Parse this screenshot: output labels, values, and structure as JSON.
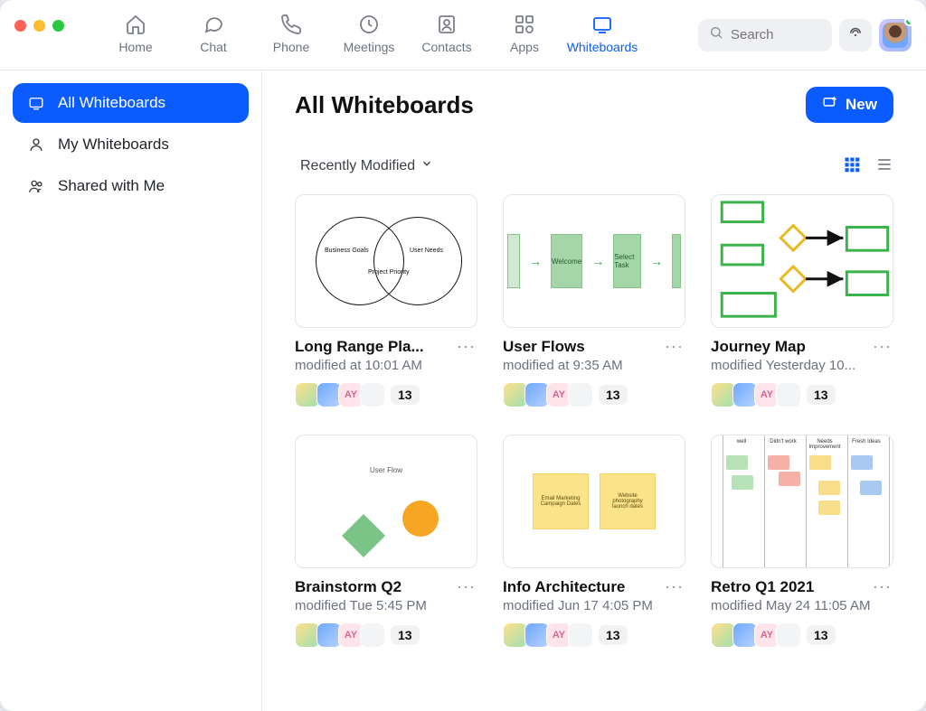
{
  "nav": {
    "items": [
      {
        "label": "Home"
      },
      {
        "label": "Chat"
      },
      {
        "label": "Phone"
      },
      {
        "label": "Meetings"
      },
      {
        "label": "Contacts"
      },
      {
        "label": "Apps"
      },
      {
        "label": "Whiteboards"
      }
    ],
    "search_placeholder": "Search"
  },
  "sidebar": {
    "items": [
      {
        "label": "All Whiteboards"
      },
      {
        "label": "My Whiteboards"
      },
      {
        "label": "Shared with Me"
      }
    ]
  },
  "main": {
    "title": "All Whiteboards",
    "new_label": "New",
    "sort_label": "Recently Modified"
  },
  "cards": [
    {
      "title": "Long Range Pla...",
      "modified": "modified at 10:01 AM",
      "collab_initials": "AY",
      "more_count": "13"
    },
    {
      "title": "User Flows",
      "modified": "modified at 9:35 AM",
      "collab_initials": "AY",
      "more_count": "13"
    },
    {
      "title": "Journey Map",
      "modified": "modified Yesterday 10...",
      "collab_initials": "AY",
      "more_count": "13"
    },
    {
      "title": "Brainstorm Q2",
      "modified": "modified Tue 5:45 PM",
      "collab_initials": "AY",
      "more_count": "13"
    },
    {
      "title": "Info Architecture",
      "modified": "modified Jun 17 4:05 PM",
      "collab_initials": "AY",
      "more_count": "13"
    },
    {
      "title": "Retro Q1 2021",
      "modified": "modified May 24 11:05 AM",
      "collab_initials": "AY",
      "more_count": "13"
    }
  ],
  "thumbs": {
    "venn": {
      "left": "Business Goals",
      "right": "User Needs",
      "center": "Project Priority"
    },
    "flow": {
      "a": "Welcome",
      "b": "Select Task"
    },
    "shapes_title": "User Flow",
    "notes": {
      "a": "Email Marketing Campaign Dates",
      "b": "Website photography launch dates"
    },
    "retro_headers": [
      "well",
      "Didn't work",
      "Needs Improvement",
      "Fresh Ideas"
    ]
  }
}
